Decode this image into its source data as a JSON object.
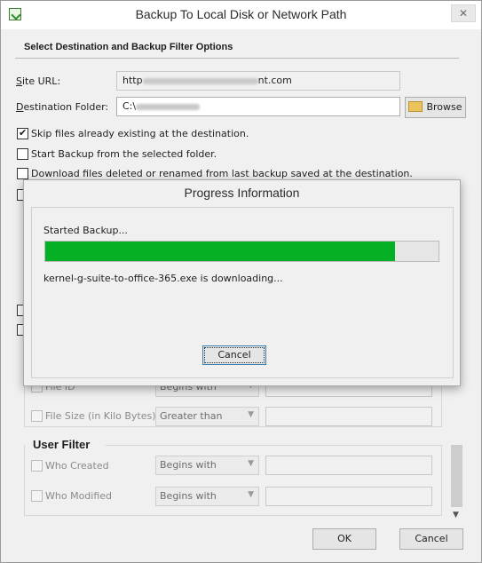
{
  "window": {
    "title": "Backup To Local Disk or Network Path",
    "close_glyph": "✕"
  },
  "group": {
    "title": "Select Destination and Backup Filter Options"
  },
  "site_url": {
    "label": "Site URL:",
    "prefix": "http",
    "suffix": "nt.com"
  },
  "destination": {
    "label": "Destination Folder:",
    "prefix": "C:\\",
    "browse_label": "Browse"
  },
  "options": [
    {
      "label": "Skip files already existing at the destination.",
      "checked": true
    },
    {
      "label": "Start Backup from the selected folder.",
      "checked": false
    },
    {
      "label": "Download files deleted or renamed from last backup saved at the destination.",
      "checked": false
    }
  ],
  "file_filters": [
    {
      "label": "File ID",
      "operator": "Begins with"
    },
    {
      "label": "File Size (in Kilo Bytes)",
      "operator": "Greater than"
    }
  ],
  "user_filter": {
    "title": "User Filter",
    "rows": [
      {
        "label": "Who Created",
        "operator": "Begins with"
      },
      {
        "label": "Who Modified",
        "operator": "Begins with"
      }
    ]
  },
  "footer": {
    "ok_label": "OK",
    "cancel_label": "Cancel"
  },
  "progress_dialog": {
    "title": "Progress Information",
    "status": "Started Backup...",
    "progress": 0.89,
    "message": "kernel-g-suite-to-office-365.exe is downloading...",
    "cancel_label": "Cancel"
  },
  "colors": {
    "progress": "#06b025",
    "background": "#f0f0f0"
  }
}
